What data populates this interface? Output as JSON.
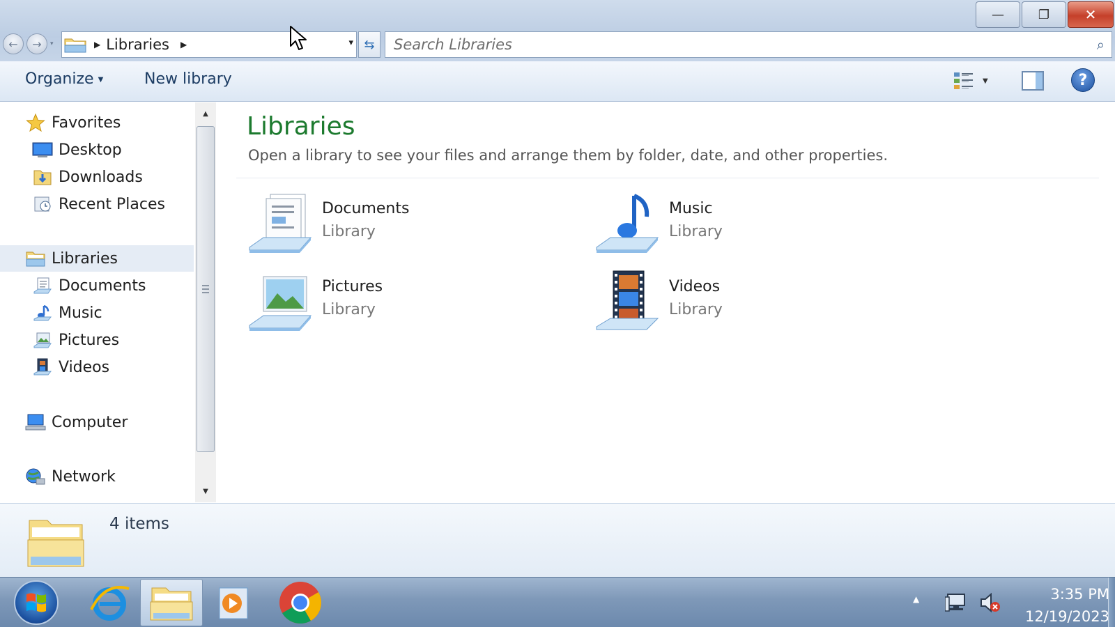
{
  "window": {
    "minimize_glyph": "—",
    "restore_glyph": "❐",
    "close_glyph": "✕"
  },
  "address_bar": {
    "breadcrumb": "Libraries",
    "dropdown_glyph": "▾",
    "refresh_glyph": "⇆"
  },
  "search": {
    "placeholder": "Search Libraries"
  },
  "toolbar": {
    "organize_label": "Organize",
    "new_library_label": "New library",
    "help_label": "?"
  },
  "nav": {
    "favorites": "Favorites",
    "desktop": "Desktop",
    "downloads": "Downloads",
    "recent_places": "Recent Places",
    "libraries": "Libraries",
    "documents": "Documents",
    "music": "Music",
    "pictures": "Pictures",
    "videos": "Videos",
    "computer": "Computer",
    "network": "Network"
  },
  "content": {
    "title": "Libraries",
    "subtitle": "Open a library to see your files and arrange them by folder, date, and other properties.",
    "libraries": [
      {
        "name": "Documents",
        "type": "Library",
        "icon": "documents-library-icon"
      },
      {
        "name": "Music",
        "type": "Library",
        "icon": "music-library-icon"
      },
      {
        "name": "Pictures",
        "type": "Library",
        "icon": "pictures-library-icon"
      },
      {
        "name": "Videos",
        "type": "Library",
        "icon": "videos-library-icon"
      }
    ]
  },
  "details": {
    "item_count": "4 items"
  },
  "taskbar": {
    "time": "3:35 PM",
    "date": "12/19/2023",
    "apps": [
      "internet-explorer-icon",
      "windows-explorer-icon",
      "media-player-icon",
      "chrome-icon"
    ]
  },
  "colors": {
    "title_green": "#1c7a2e",
    "toolbar_text": "#1c3c63",
    "selection": "#e5ecf5",
    "close_red": "#c5402a"
  }
}
